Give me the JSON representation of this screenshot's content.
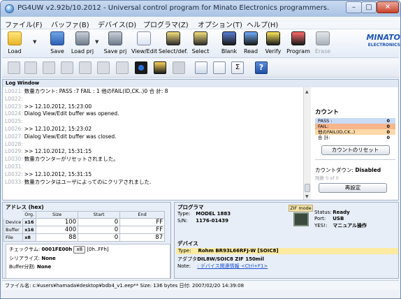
{
  "window": {
    "title": "PG4UW v2.92b/10.2012 - Universal control program for Minato Electronics programmers."
  },
  "menu": [
    "ファイル(F)",
    "バッファ(B)",
    "デバイス(D)",
    "プログラマ(Z)",
    "オプション(T)",
    "ヘルプ(H)"
  ],
  "toolbar": {
    "load": "Load",
    "save": "Save",
    "load_prj": "Load prj",
    "save_prj": "Save prj",
    "view_edit": "View/Edit",
    "select_def": "Select/def.",
    "select": "Select",
    "blank": "Blank",
    "read": "Read",
    "verify": "Verify",
    "program": "Program",
    "erase": "Erase"
  },
  "logo": {
    "name": "MINATO",
    "sub": "ELECTRONICS"
  },
  "log": {
    "title": "Log Window",
    "lines": [
      {
        "no": "L0021:",
        "text": "数量カウント: PASS :7   FAIL : 1  他のFAIL(ID,CK..)0  合 計: 8"
      },
      {
        "no": "L0022:",
        "text": ""
      },
      {
        "no": "L0023:",
        "text": ">> 12.10.2012, 15:23:00"
      },
      {
        "no": "L0024:",
        "text": "Dialog View/Edit buffer was opened."
      },
      {
        "no": "L0025:",
        "text": ""
      },
      {
        "no": "L0026:",
        "text": ">> 12.10.2012, 15:23:02"
      },
      {
        "no": "L0027:",
        "text": "Dialog View/Edit buffer was closed."
      },
      {
        "no": "L0028:",
        "text": ""
      },
      {
        "no": "L0029:",
        "text": ">> 12.10.2012, 15:31:15"
      },
      {
        "no": "L0030:",
        "text": "数量カウンターがリセットされました。"
      },
      {
        "no": "L0031:",
        "text": ""
      },
      {
        "no": "L0032:",
        "text": ">> 12.10.2012, 15:31:15"
      },
      {
        "no": "L0033:",
        "text": "数量カウンタはユーザによってのにクリアされました."
      }
    ]
  },
  "count": {
    "title": "カウント",
    "pass_label": "PASS :",
    "pass_value": "0",
    "fail_label": "FAIL:",
    "fail_value": "0",
    "other_label": "他のFAIL(ID,CK..)",
    "other_value": "0",
    "total_label": "合 計:",
    "total_value": "0",
    "reset_button": "カウントのリセット",
    "countdown_label": "カウントダウン:",
    "countdown_value": "Disabled",
    "remaining": "残数  0 of 0",
    "reset_setting_button": "再設定"
  },
  "address": {
    "title": "アドレス (hex)",
    "headers": [
      "Org.",
      "Size",
      "Start",
      "End"
    ],
    "rows": [
      {
        "label": "Device",
        "org": "x16",
        "size": "100",
        "start": "0",
        "end": "FF"
      },
      {
        "label": "Buffer",
        "org": "x16",
        "size": "400",
        "start": "0",
        "end": "FF"
      },
      {
        "label": "File",
        "org": "x8",
        "size": "88",
        "start": "0",
        "end": "87"
      }
    ],
    "checksum_label": "チェックサム:",
    "checksum_value": "0001FE00h",
    "checksum_btn": "x8",
    "checksum_range": "[0h..FFh]",
    "serial_label": "シリアライズ:",
    "serial_value": "None",
    "split_label": "Buffer分割:",
    "split_value": "None"
  },
  "programmer": {
    "title": "プログラマ",
    "type_label": "Type:",
    "type_value": "MODEL 1883",
    "sn_label": "S/N:",
    "sn_value": "1176-01439",
    "zif_label": "ZIF mode",
    "status_label": "Status:",
    "status_value": "Ready",
    "port_label": "Port:",
    "port_value": "USB",
    "yes_label": "YES!:",
    "yes_value": "マニュアル操作"
  },
  "device": {
    "title": "デバイス",
    "type_label": "Type:",
    "type_value": "Rohm  BR93L66RFJ-W [SOIC8]",
    "adapter_label": "アダプタ:",
    "adapter_value": "DIL8W/SOIC8 ZIF 150mil",
    "note_label": "Note:",
    "note_value": ": デバイス関連情報 <Ctrl+F1>"
  },
  "statusbar": {
    "text": "ファイル名:  c:¥users¥hamada¥desktop¥bdb4_v1.eep**   Size:  136 bytes   日付:  2007/02/20 14:39:08"
  }
}
